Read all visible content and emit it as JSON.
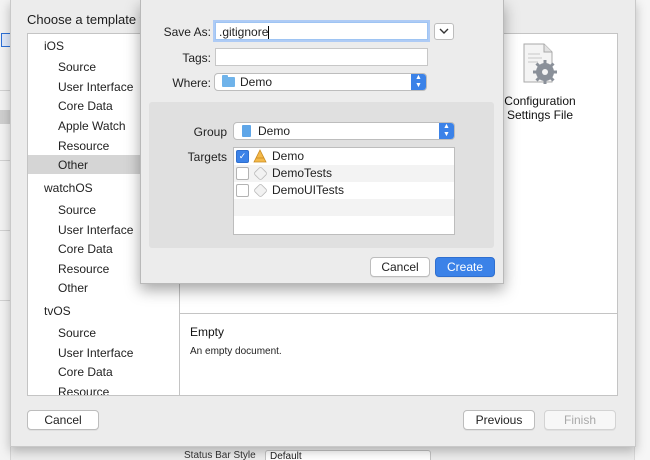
{
  "chooser": {
    "title": "Choose a template for",
    "sidebar": [
      {
        "section": "iOS",
        "items": [
          "Source",
          "User Interface",
          "Core Data",
          "Apple Watch",
          "Resource",
          "Other"
        ]
      },
      {
        "section": "watchOS",
        "items": [
          "Source",
          "User Interface",
          "Core Data",
          "Resource",
          "Other"
        ]
      },
      {
        "section": "tvOS",
        "items": [
          "Source",
          "User Interface",
          "Core Data",
          "Resource"
        ]
      }
    ],
    "selected_item": "Other",
    "template": {
      "label_line1": "Configuration",
      "label_line2": "Settings File"
    },
    "detail": {
      "title": "Empty",
      "description": "An empty document."
    },
    "buttons": {
      "cancel": "Cancel",
      "previous": "Previous",
      "finish": "Finish"
    }
  },
  "save_sheet": {
    "save_as_label": "Save As:",
    "save_as_value": ".gitignore",
    "tags_label": "Tags:",
    "where_label": "Where:",
    "where_value": "Demo",
    "group_label": "Group",
    "group_value": "Demo",
    "targets_label": "Targets",
    "targets": [
      {
        "name": "Demo",
        "checked": true
      },
      {
        "name": "DemoTests",
        "checked": false
      },
      {
        "name": "DemoUITests",
        "checked": false
      }
    ],
    "cancel_label": "Cancel",
    "create_label": "Create"
  },
  "background_row": {
    "label": "Status Bar Style",
    "value": "Default"
  },
  "colors": {
    "accent": "#3b82e8",
    "selection": "#d5d5d5"
  }
}
